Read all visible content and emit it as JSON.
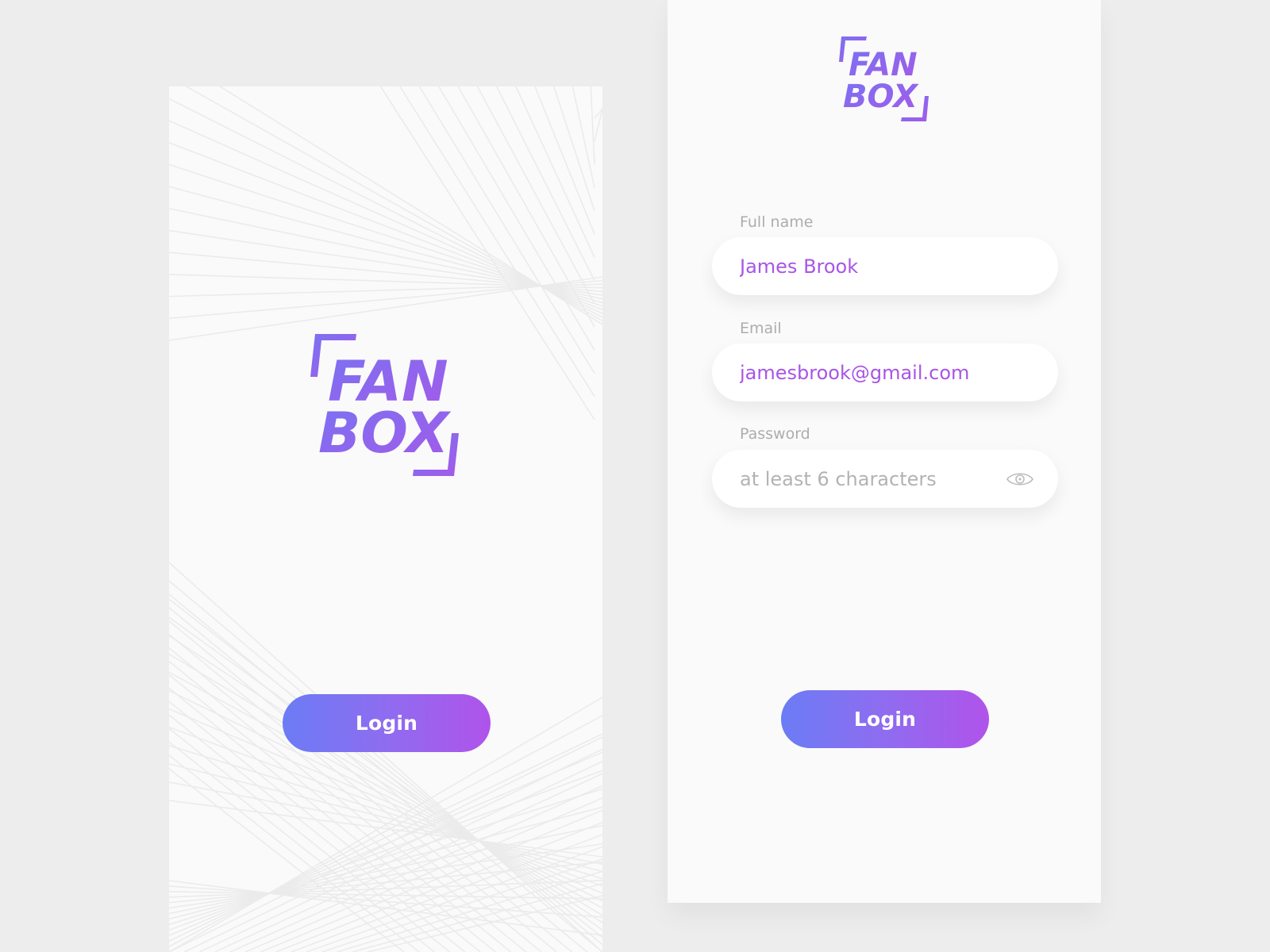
{
  "splash": {
    "logo": {
      "line1": "FAN",
      "line2": "BOX"
    },
    "login_label": "Login"
  },
  "form": {
    "logo": {
      "line1": "FAN",
      "line2": "BOX"
    },
    "full_name": {
      "label": "Full name",
      "value": "James Brook"
    },
    "email": {
      "label": "Email",
      "value": "jamesbrook@gmail.com"
    },
    "password": {
      "label": "Password",
      "value": "",
      "placeholder": "at least 6 characters",
      "toggle_icon": "eye-icon"
    },
    "login_label": "Login"
  },
  "colors": {
    "gradient_start": "#6b7cf5",
    "gradient_end": "#b053ea",
    "input_text": "#a855e6",
    "label": "#adadad",
    "background": "#ededed",
    "screen": "#fafafa"
  }
}
